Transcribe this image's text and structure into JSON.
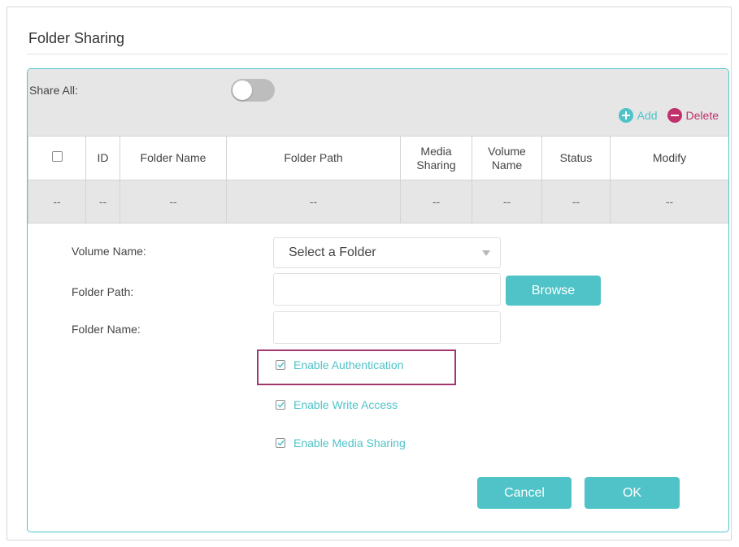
{
  "page": {
    "title": "Folder Sharing"
  },
  "share_all": {
    "label": "Share All:",
    "enabled": false
  },
  "actions": {
    "add_label": "Add",
    "delete_label": "Delete"
  },
  "table": {
    "headers": [
      "ID",
      "Folder Name",
      "Folder Path",
      "Media Sharing",
      "Volume Name",
      "Status",
      "Modify"
    ],
    "rows": [
      [
        "--",
        "--",
        "--",
        "--",
        "--",
        "--",
        "--",
        "--"
      ]
    ]
  },
  "form": {
    "volume_name_label": "Volume Name:",
    "volume_name_value": "Select a Folder",
    "folder_path_label": "Folder Path:",
    "folder_path_value": "",
    "folder_name_label": "Folder Name:",
    "folder_name_value": "",
    "browse_label": "Browse",
    "options": [
      {
        "label": "Enable Authentication",
        "checked": true
      },
      {
        "label": "Enable Write Access",
        "checked": true
      },
      {
        "label": "Enable Media Sharing",
        "checked": true
      }
    ],
    "cancel_label": "Cancel",
    "ok_label": "OK"
  },
  "colors": {
    "accent": "#4fc3c8",
    "delete": "#c0306c",
    "highlight": "#a0386e",
    "band": "#e6e6e6"
  }
}
